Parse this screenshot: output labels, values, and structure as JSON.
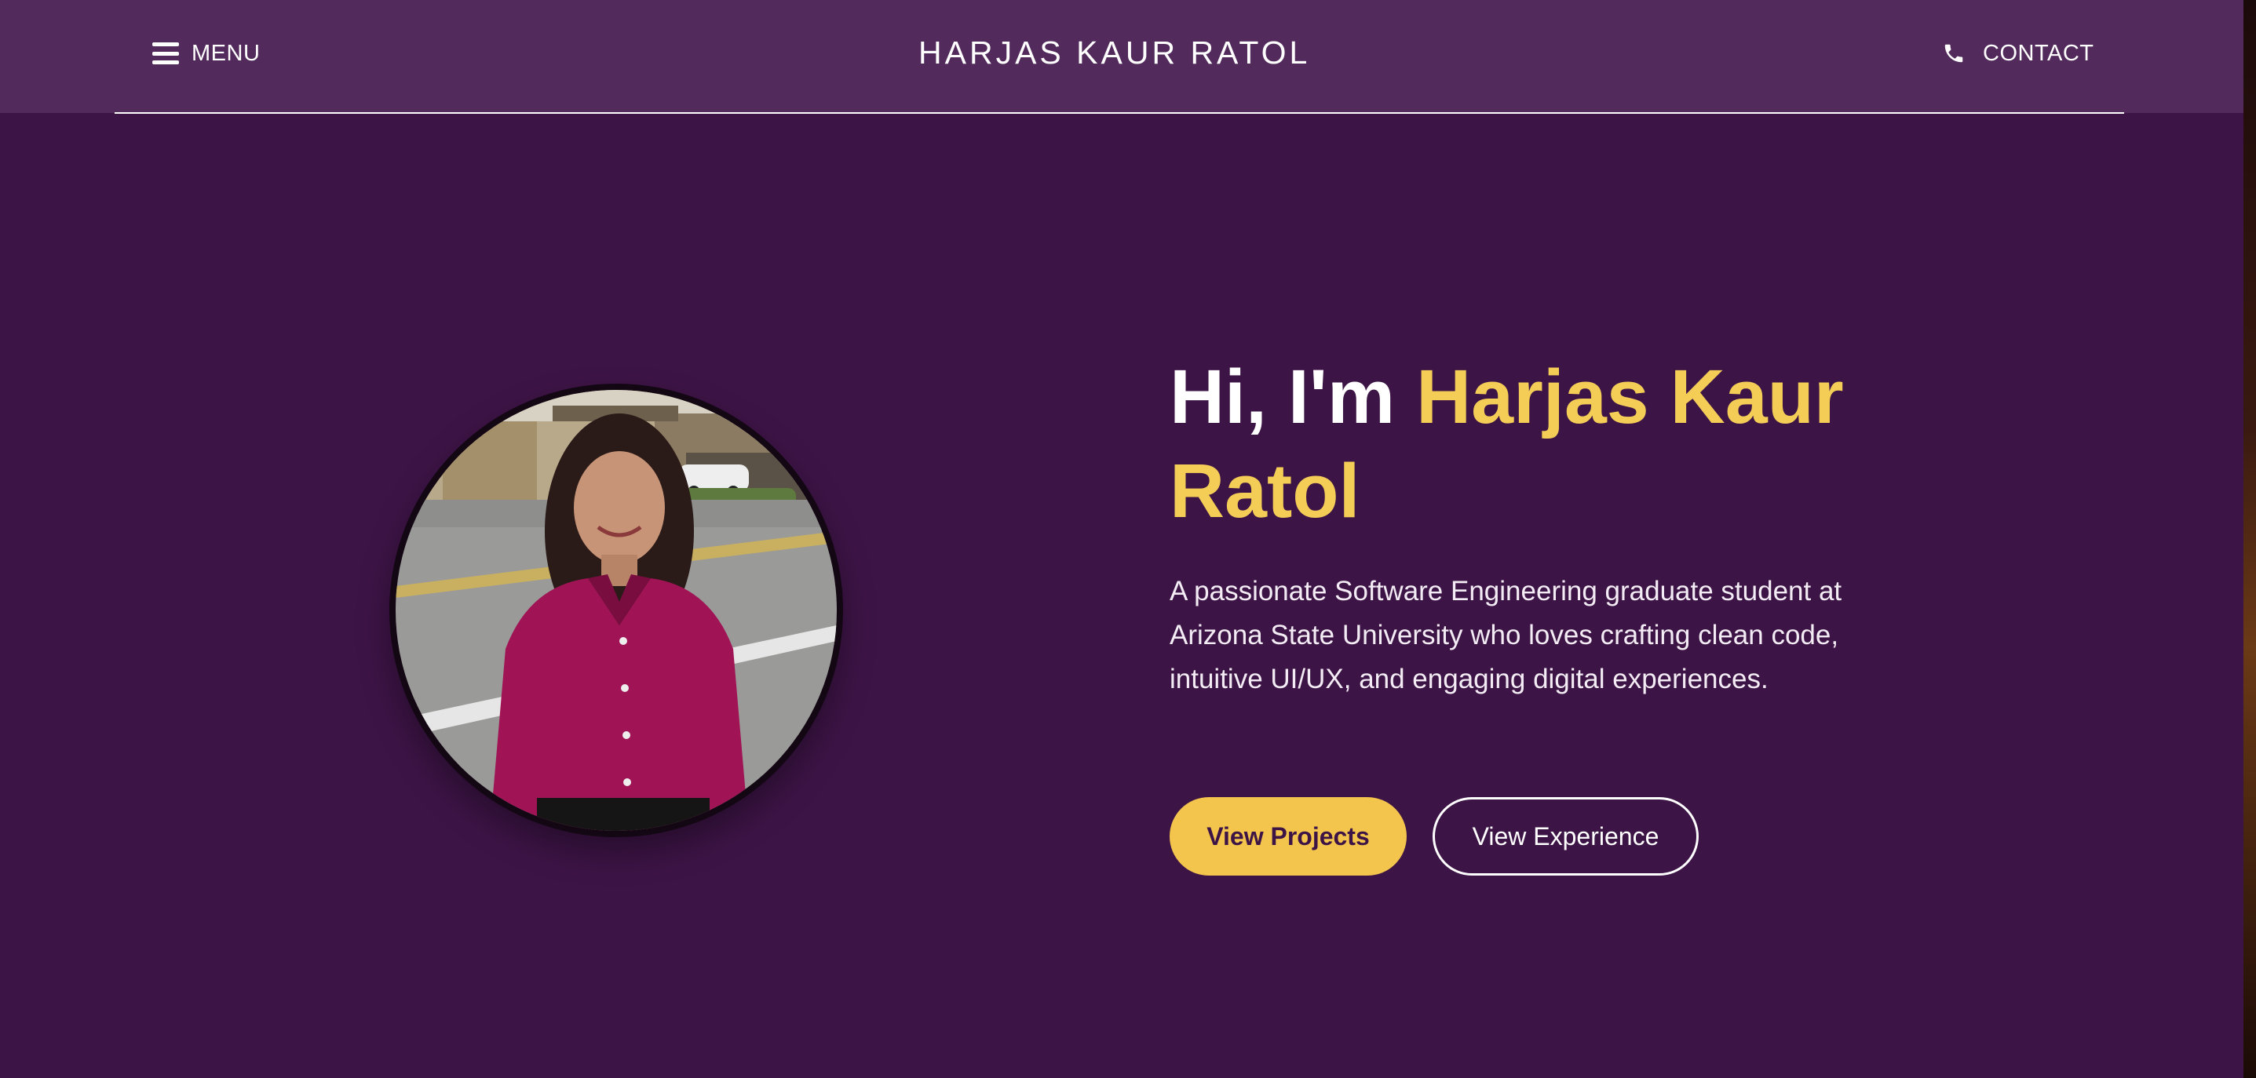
{
  "colors": {
    "page_bg": "#3d1446",
    "header_bg": "#522a5c",
    "accent": "#f4cd57",
    "primary_button_bg": "#f4c54d",
    "text": "#ffffff"
  },
  "header": {
    "menu_icon": "hamburger-menu-icon",
    "menu_label": "MENU",
    "brand_name": "HARJAS KAUR RATOL",
    "contact_icon": "phone-icon",
    "contact_label": "CONTACT"
  },
  "hero": {
    "photo_icon": "profile-photo",
    "greeting": "Hi, I'm",
    "name": "Harjas Kaur Ratol",
    "description": "A passionate Software Engineering graduate student at Arizona State University who loves crafting clean code, intuitive UI/UX, and engaging digital experiences.",
    "buttons": {
      "primary": "View Projects",
      "secondary": "View Experience"
    }
  }
}
